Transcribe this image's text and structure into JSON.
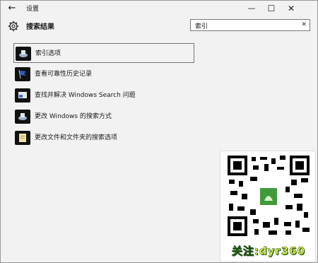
{
  "window": {
    "title": "设置",
    "controls": {
      "minimize": "—",
      "maximize": "☐",
      "close": "✕"
    }
  },
  "header": {
    "page_title": "搜索结果",
    "gear_icon": "gear-icon",
    "back_icon": "back-arrow-icon"
  },
  "search": {
    "value": "索引",
    "clear_symbol": "✕"
  },
  "results": [
    {
      "label": "索引选项",
      "icon": "indexing-options-icon",
      "selected": true
    },
    {
      "label": "查看可靠性历史记录",
      "icon": "reliability-flag-icon",
      "selected": false
    },
    {
      "label": "查找并解决 Windows Search 问题",
      "icon": "troubleshoot-icon",
      "selected": false
    },
    {
      "label": "更改 Windows 的搜索方式",
      "icon": "search-settings-icon",
      "selected": false
    },
    {
      "label": "更改文件和文件夹的搜索选项",
      "icon": "folder-options-icon",
      "selected": false
    }
  ],
  "watermark": {
    "caption": "关注:dyr360",
    "icon": "qr-code-icon"
  },
  "colors": {
    "background": "#f2f2f2",
    "caption_fill": "#e9f84a",
    "caption_outline": "#1f4f15"
  }
}
